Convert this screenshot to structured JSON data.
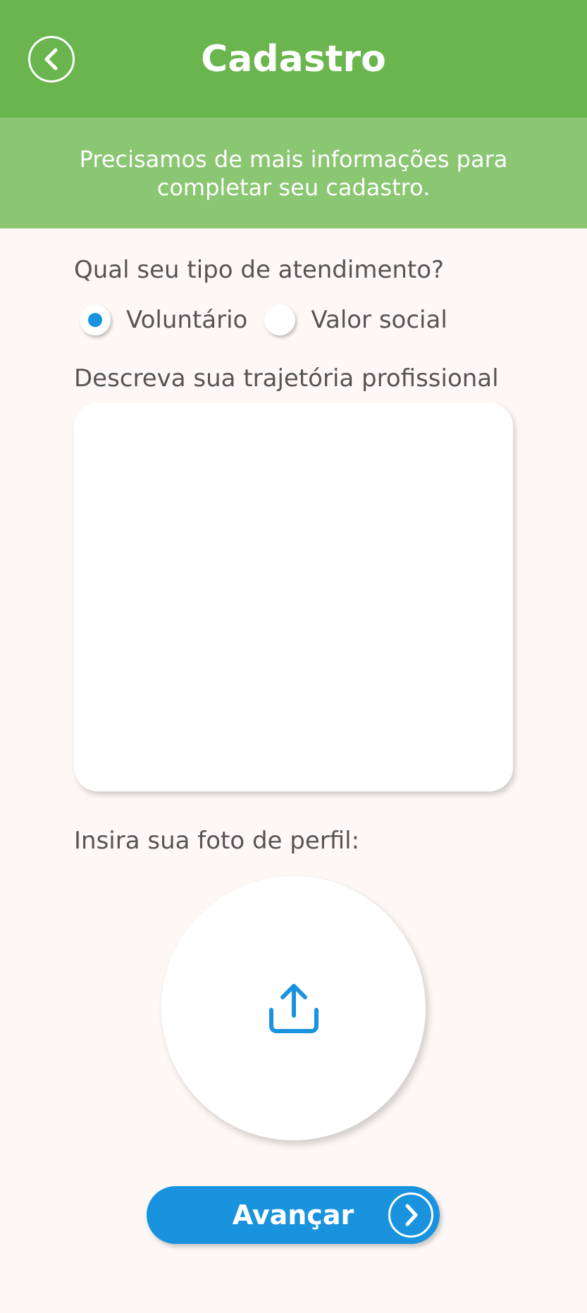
{
  "header": {
    "title": "Cadastro",
    "back_icon": "chevron-left-icon",
    "background_color": "#6ab54e"
  },
  "banner": {
    "text": "Precisamos de mais informações para completar seu cadastro.",
    "background_color": "#8bc673"
  },
  "form": {
    "attendance_question": "Qual seu tipo de atendimento?",
    "attendance_options": [
      {
        "label": "Voluntário",
        "selected": true
      },
      {
        "label": "Valor social",
        "selected": false
      }
    ],
    "trajectory_label": "Descreva sua trajetória profissional",
    "trajectory_value": "",
    "photo_label": "Insira sua foto de perfil:",
    "photo_icon": "upload-icon"
  },
  "next_button": {
    "label": "Avançar",
    "icon": "chevron-right-icon",
    "color": "#1a93df"
  }
}
